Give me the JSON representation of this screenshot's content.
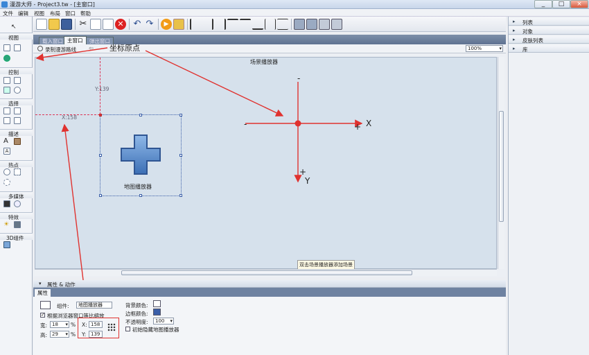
{
  "window": {
    "title": "漫游大师 - Project3.tw - [主窗口]",
    "controls": [
      "_",
      "□",
      "×"
    ]
  },
  "menu": [
    "文件",
    "编辑",
    "视图",
    "布局",
    "窗口",
    "帮助"
  ],
  "left_panel": {
    "sections": [
      {
        "label": "视图",
        "icons": [
          "select-cursor-icon",
          "rectangle-icon",
          "circle-select-icon",
          "globe-icon"
        ]
      },
      {
        "label": "控制",
        "icons": [
          "control-panel-icon",
          "button-icon",
          "chart-icon",
          "disable-icon"
        ]
      },
      {
        "label": "选择",
        "icons": [
          "image-icon",
          "list-icon",
          "picture-icon",
          "edit-icon"
        ]
      },
      {
        "label": "描述",
        "icons": [
          "text-icon",
          "image-text-icon",
          "text-box-icon"
        ]
      },
      {
        "label": "热点",
        "icons": [
          "hotspot-icon",
          "rect-hotspot-icon",
          "polygon-hotspot-icon"
        ]
      },
      {
        "label": "多媒体",
        "icons": [
          "video-icon",
          "compass-icon"
        ]
      },
      {
        "label": "特效",
        "icons": [
          "sun-effect-icon",
          "snow-effect-icon"
        ]
      },
      {
        "label": "3D组件",
        "icons": [
          "3d-component-icon"
        ]
      }
    ]
  },
  "tabs": [
    {
      "label": "载入窗口",
      "active": false
    },
    {
      "label": "主窗口",
      "active": true
    },
    {
      "label": "弹出窗口",
      "active": false
    }
  ],
  "subtoolbar": {
    "record_path": "录制漫游路线",
    "zoom": "100%"
  },
  "canvas": {
    "scene_player_label": "场景播放器",
    "map_player_label": "地图播放器",
    "y_coord_label": "Y:139",
    "x_coord_label": "X:158",
    "hint": "双击场景播放器添加场景"
  },
  "annotations": {
    "origin_label": "坐标原点",
    "axis_x": "X",
    "axis_y": "Y",
    "minus_top": "-",
    "minus_left": "-",
    "plus_right": "+",
    "plus_bottom": "+",
    "accent_color": "#e0322f"
  },
  "right_panel": {
    "items": [
      "列表",
      "对象",
      "皮肤列表",
      "库"
    ]
  },
  "properties": {
    "header": "属性 & 动作",
    "tab": "属性",
    "component_label": "组件:",
    "component_value": "地图播放器",
    "scale_checkbox": "根据浏览器窗口等比缩放",
    "width_label": "宽:",
    "width_value": "18",
    "height_label": "高:",
    "height_value": "29",
    "percent": "%",
    "x_label": "X:",
    "x_value": "158",
    "y_label": "Y:",
    "y_value": "139",
    "bg_color_label": "背景颜色:",
    "border_color_label": "边框颜色:",
    "opacity_label": "不透明度:",
    "opacity_value": "100",
    "hide_label": "初始隐藏地图播放器"
  }
}
